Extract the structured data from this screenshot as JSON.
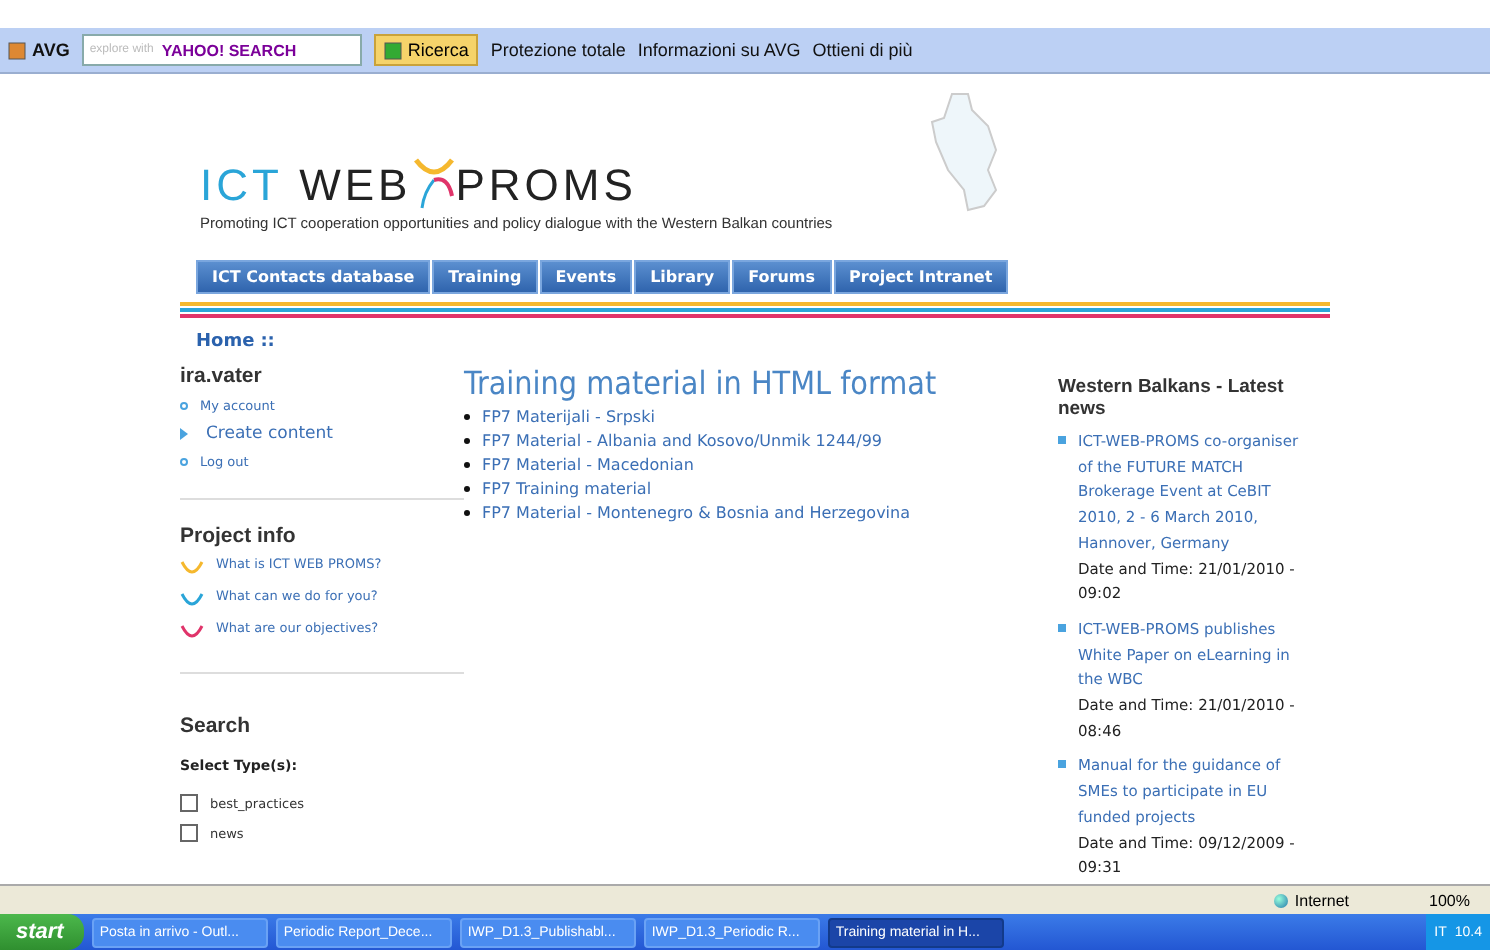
{
  "toolbar": {
    "brand": "AVG",
    "search_placeholder": "explore with",
    "search_brand": "YAHOO! SEARCH",
    "search_button": "Ricerca",
    "items": [
      "Protezione totale",
      "Informazioni su AVG",
      "Ottieni di più"
    ]
  },
  "header": {
    "logo_left": "ICT",
    "logo_mid": "WEB",
    "logo_right": "PROMS",
    "tagline": "Promoting ICT cooperation opportunities and policy dialogue with the Western Balkan countries"
  },
  "nav": [
    {
      "label": "ICT Contacts database"
    },
    {
      "label": "Training"
    },
    {
      "label": "Events"
    },
    {
      "label": "Library"
    },
    {
      "label": "Forums"
    },
    {
      "label": "Project Intranet"
    }
  ],
  "breadcrumb": {
    "home": "Home",
    "sep": "::"
  },
  "user": {
    "name": "ira.vater",
    "links": [
      {
        "label": "My account",
        "kind": "small"
      },
      {
        "label": "Create content",
        "kind": "large"
      },
      {
        "label": "Log out",
        "kind": "small"
      }
    ]
  },
  "project_info": {
    "title": "Project info",
    "links": [
      {
        "label": "What is ICT WEB PROMS?",
        "color": "#f5b82e"
      },
      {
        "label": "What can we do for you?",
        "color": "#2aa5d8"
      },
      {
        "label": "What are our objectives?",
        "color": "#e0346a"
      }
    ]
  },
  "search": {
    "title": "Search",
    "subtitle": "Select Type(s):",
    "types": [
      {
        "label": "best_practices",
        "checked": false
      },
      {
        "label": "news",
        "checked": false
      }
    ]
  },
  "main": {
    "title": "Training material in HTML format",
    "items": [
      "FP7 Materijali - Srpski",
      "FP7 Material - Albania and Kosovo/Unmik 1244/99",
      "FP7 Material - Macedonian",
      "FP7 Training material",
      "FP7 Material - Montenegro & Bosnia and Herzegovina"
    ]
  },
  "news": {
    "title": "Western Balkans - Latest news",
    "items": [
      {
        "headline": "ICT-WEB-PROMS co-organiser of the FUTURE MATCH Brokerage Event at CeBIT 2010, 2 - 6 March 2010, Hannover, Germany",
        "date": "Date and Time: 21/01/2010 - 09:02"
      },
      {
        "headline": "ICT-WEB-PROMS publishes White Paper on eLearning in the WBC",
        "date": "Date and Time: 21/01/2010 - 08:46"
      },
      {
        "headline": "Manual for the guidance of SMEs to participate in EU funded projects",
        "date": "Date and Time: 09/12/2009 - 09:31"
      }
    ]
  },
  "status_bar": {
    "zone": "Internet",
    "zoom": "100%"
  },
  "taskbar": {
    "start": "start",
    "tasks": [
      {
        "label": "Posta in arrivo - Outl...",
        "selected": false
      },
      {
        "label": "Periodic Report_Dece...",
        "selected": false
      },
      {
        "label": "IWP_D1.3_Publishabl...",
        "selected": false
      },
      {
        "label": "IWP_D1.3_Periodic R...",
        "selected": false
      },
      {
        "label": "Training material in H...",
        "selected": true
      }
    ],
    "lang": "IT",
    "clock": "10.4"
  }
}
